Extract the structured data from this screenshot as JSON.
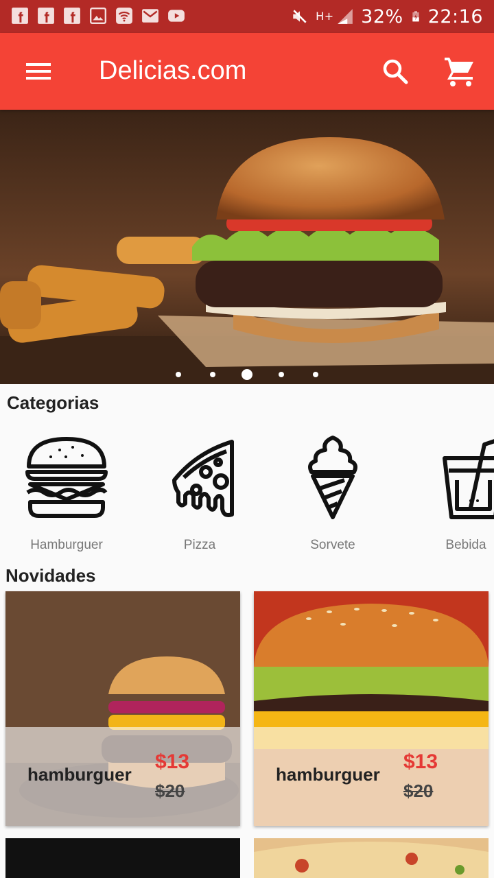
{
  "status_bar": {
    "battery": "32%",
    "time": "22:16",
    "network": "H+",
    "icons": [
      "facebook-icon",
      "facebook-icon",
      "facebook-icon",
      "gallery-icon",
      "wifi-icon",
      "gmail-icon",
      "youtube-icon",
      "mute-icon",
      "network-icon",
      "signal-icon",
      "battery-charging-icon"
    ]
  },
  "appbar": {
    "title": "Delicias.com",
    "color": "#f44336",
    "icons": [
      "menu-icon",
      "search-icon",
      "cart-icon"
    ]
  },
  "banner": {
    "page_count": 5,
    "active_index": 2
  },
  "sections": {
    "categories_title": "Categorias",
    "news_title": "Novidades"
  },
  "categories": [
    {
      "label": "Hamburguer",
      "icon": "hamburger-icon"
    },
    {
      "label": "Pizza",
      "icon": "pizza-icon"
    },
    {
      "label": "Sorvete",
      "icon": "ice-cream-icon"
    },
    {
      "label": "Bebida",
      "icon": "drink-icon"
    }
  ],
  "products": [
    {
      "name": "hamburguer",
      "price": "$13",
      "old_price": "$20"
    },
    {
      "name": "hamburguer",
      "price": "$13",
      "old_price": "$20"
    }
  ],
  "colors": {
    "primary": "#f44336",
    "status_bar": "#b32a26",
    "price": "#e53935"
  }
}
